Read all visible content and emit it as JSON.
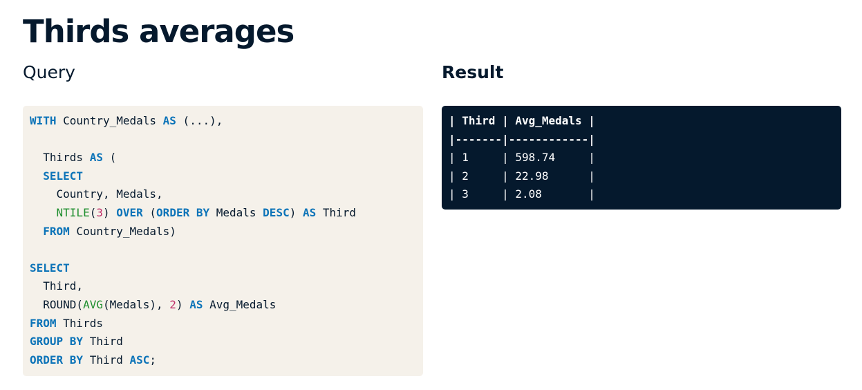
{
  "page": {
    "title": "Thirds averages"
  },
  "query": {
    "heading": "Query",
    "lines": [
      [
        {
          "t": "WITH",
          "c": "kw"
        },
        {
          "t": " Country_Medals ",
          "c": ""
        },
        {
          "t": "AS",
          "c": "kw"
        },
        {
          "t": " (...),",
          "c": ""
        }
      ],
      [],
      [
        {
          "t": "  Thirds ",
          "c": ""
        },
        {
          "t": "AS",
          "c": "kw"
        },
        {
          "t": " (",
          "c": ""
        }
      ],
      [
        {
          "t": "  ",
          "c": ""
        },
        {
          "t": "SELECT",
          "c": "kw"
        }
      ],
      [
        {
          "t": "    Country, Medals,",
          "c": ""
        }
      ],
      [
        {
          "t": "    ",
          "c": ""
        },
        {
          "t": "NTILE",
          "c": "fn"
        },
        {
          "t": "(",
          "c": ""
        },
        {
          "t": "3",
          "c": "num"
        },
        {
          "t": ") ",
          "c": ""
        },
        {
          "t": "OVER",
          "c": "kw"
        },
        {
          "t": " (",
          "c": ""
        },
        {
          "t": "ORDER BY",
          "c": "kw"
        },
        {
          "t": " Medals ",
          "c": ""
        },
        {
          "t": "DESC",
          "c": "kw"
        },
        {
          "t": ") ",
          "c": ""
        },
        {
          "t": "AS",
          "c": "kw"
        },
        {
          "t": " Third",
          "c": ""
        }
      ],
      [
        {
          "t": "  ",
          "c": ""
        },
        {
          "t": "FROM",
          "c": "kw"
        },
        {
          "t": " Country_Medals)",
          "c": ""
        }
      ],
      [],
      [
        {
          "t": "SELECT",
          "c": "kw"
        }
      ],
      [
        {
          "t": "  Third,",
          "c": ""
        }
      ],
      [
        {
          "t": "  ROUND(",
          "c": ""
        },
        {
          "t": "AVG",
          "c": "fn"
        },
        {
          "t": "(Medals), ",
          "c": ""
        },
        {
          "t": "2",
          "c": "num"
        },
        {
          "t": ") ",
          "c": ""
        },
        {
          "t": "AS",
          "c": "kw"
        },
        {
          "t": " Avg_Medals",
          "c": ""
        }
      ],
      [
        {
          "t": "FROM",
          "c": "kw"
        },
        {
          "t": " Thirds",
          "c": ""
        }
      ],
      [
        {
          "t": "GROUP BY",
          "c": "kw"
        },
        {
          "t": " Third",
          "c": ""
        }
      ],
      [
        {
          "t": "ORDER BY",
          "c": "kw"
        },
        {
          "t": " Third ",
          "c": ""
        },
        {
          "t": "ASC",
          "c": "kw"
        },
        {
          "t": ";",
          "c": ""
        }
      ]
    ]
  },
  "result": {
    "heading": "Result",
    "header_line": "| Third | Avg_Medals |",
    "separator_line": "|-------|------------|",
    "rows": [
      "| 1     | 598.74     |",
      "| 2     | 22.98      |",
      "| 3     | 2.08       |"
    ]
  }
}
